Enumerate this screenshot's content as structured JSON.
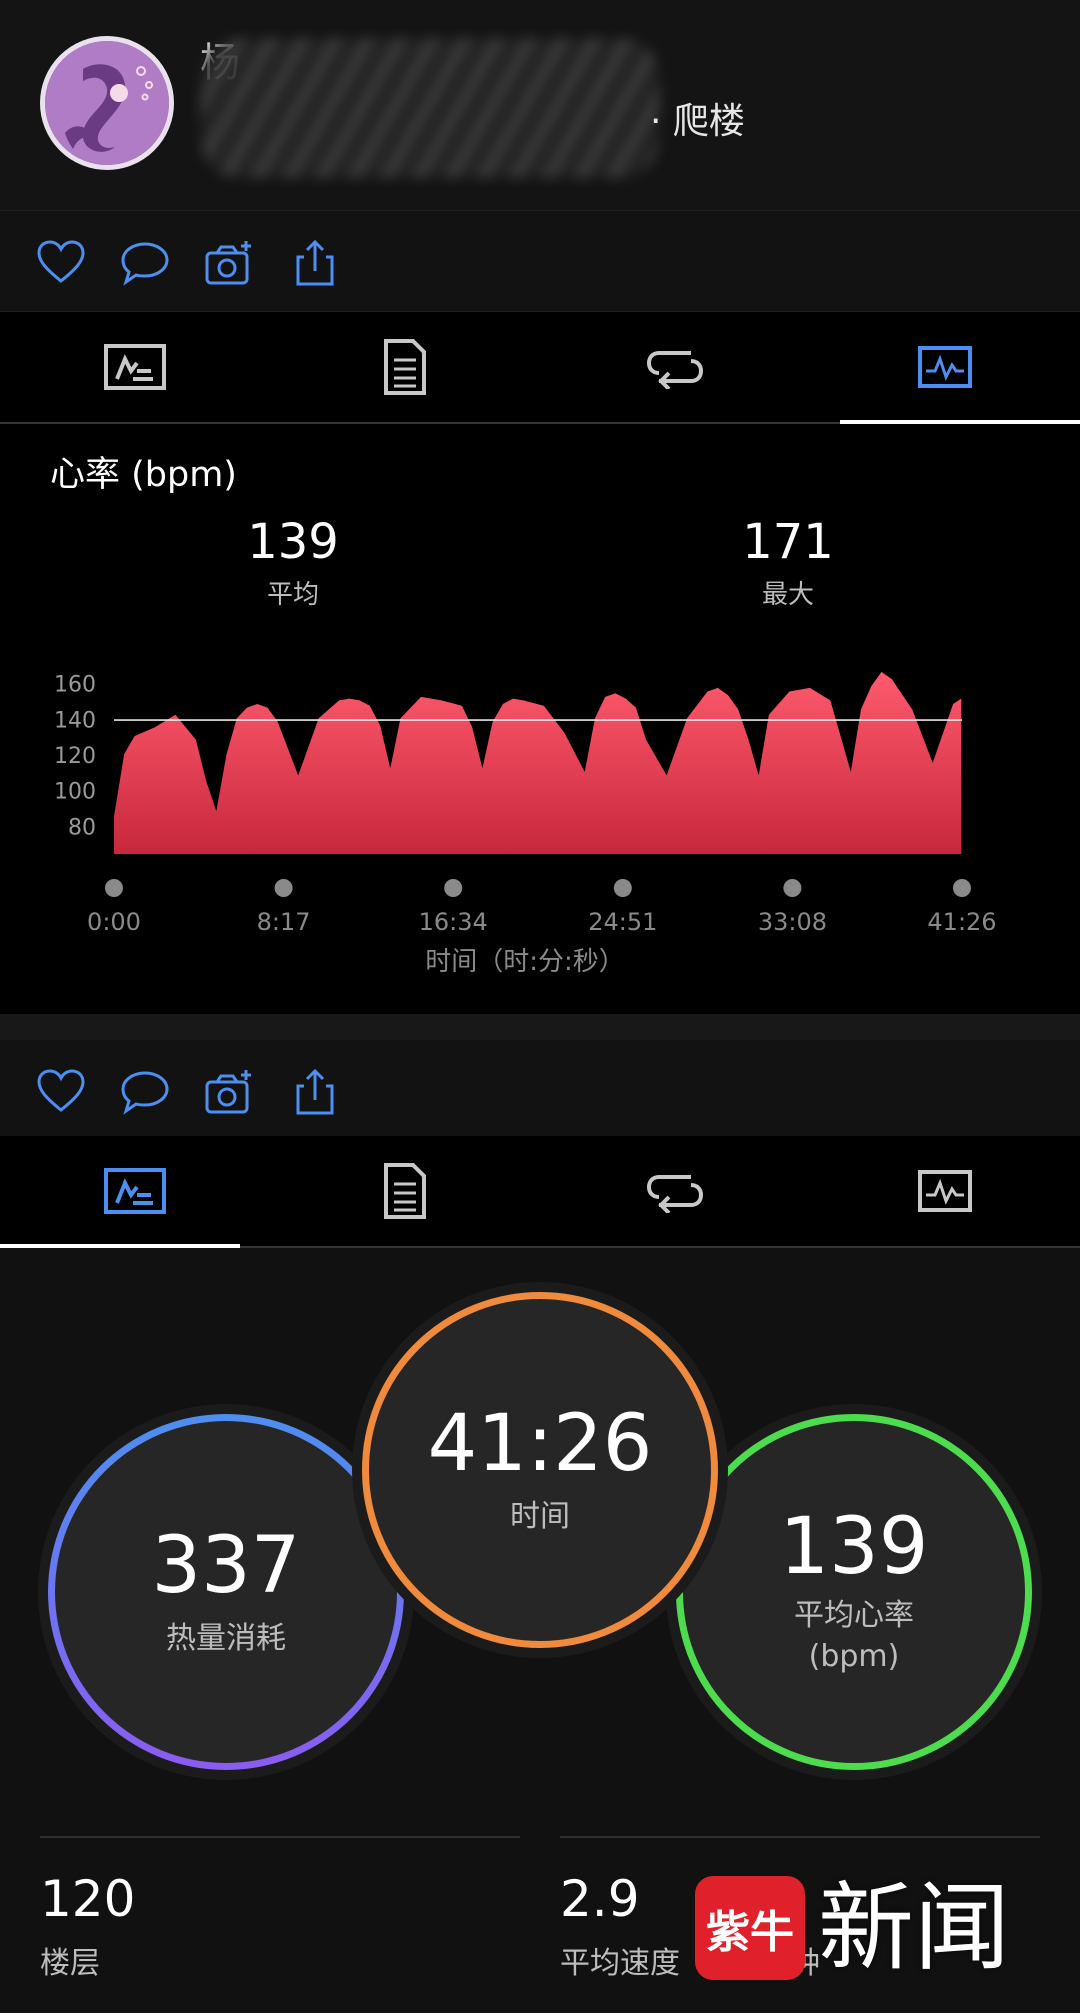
{
  "header": {
    "user_name": "杨",
    "activity_type": "· 爬楼"
  },
  "actions": [
    {
      "name": "like",
      "icon": "heart-icon"
    },
    {
      "name": "comment",
      "icon": "comment-icon"
    },
    {
      "name": "add-photo",
      "icon": "camera-plus-icon"
    },
    {
      "name": "share",
      "icon": "share-icon"
    }
  ],
  "tabs": [
    {
      "name": "summary",
      "icon": "summary-icon"
    },
    {
      "name": "details",
      "icon": "details-icon"
    },
    {
      "name": "laps",
      "icon": "laps-icon"
    },
    {
      "name": "charts",
      "icon": "chart-icon"
    }
  ],
  "heart_rate": {
    "title": "心率 (bpm)",
    "avg_value": "139",
    "avg_label": "平均",
    "max_value": "171",
    "max_label": "最大"
  },
  "chart_data": {
    "type": "area",
    "xlabel": "时间（时:分:秒）",
    "ylabel": "",
    "x_ticks": [
      "0:00",
      "8:17",
      "16:34",
      "24:51",
      "33:08",
      "41:26"
    ],
    "y_ticks": [
      160,
      140,
      120,
      100,
      80
    ],
    "reference_line": 139,
    "ylim": [
      64,
      176
    ],
    "x_minutes": [
      0,
      0.5,
      1,
      2,
      3,
      4,
      4.5,
      5,
      5.5,
      6,
      6.5,
      7,
      7.5,
      8,
      9,
      10,
      11,
      11.5,
      12,
      12.5,
      13,
      13.5,
      14,
      15,
      16,
      17,
      17.5,
      18,
      18.5,
      19,
      19.5,
      20,
      21,
      22,
      23,
      23.5,
      24,
      24.5,
      25,
      25.5,
      26,
      27,
      28,
      29,
      29.5,
      30,
      30.5,
      31,
      31.5,
      32,
      33,
      34,
      35,
      35.5,
      36,
      36.5,
      37,
      37.5,
      38,
      39,
      40,
      41,
      41.4
    ],
    "values": [
      85,
      120,
      130,
      135,
      142,
      128,
      105,
      88,
      120,
      140,
      146,
      148,
      146,
      138,
      108,
      140,
      150,
      151,
      150,
      147,
      136,
      112,
      140,
      152,
      150,
      147,
      135,
      112,
      138,
      148,
      151,
      150,
      147,
      132,
      110,
      140,
      152,
      154,
      151,
      146,
      128,
      108,
      140,
      155,
      157,
      153,
      145,
      128,
      108,
      142,
      155,
      157,
      150,
      130,
      110,
      145,
      158,
      166,
      162,
      145,
      115,
      148,
      151,
      148,
      125
    ],
    "color": "#e8425a",
    "grid": false
  },
  "summary": {
    "calories_value": "337",
    "calories_label": "热量消耗",
    "time_value": "41:26",
    "time_label": "时间",
    "avg_hr_value": "139",
    "avg_hr_label": "平均心率",
    "avg_hr_unit": "(bpm)",
    "floors_value": "120",
    "floors_label": "楼层",
    "speed_value": "2.9",
    "speed_label": "平均速度",
    "speed_unit_tail": "钟"
  },
  "watermark": {
    "logo_text": "紫牛",
    "brand_text": "新闻"
  },
  "colors": {
    "accent_blue": "#4d8ff0",
    "time_ring": "#f08a3c",
    "hr_ring": "#4ddc4d",
    "calorie_ring_start": "#4d8ff0",
    "calorie_ring_end": "#8b5cf0",
    "hr_fill": "#e8425a"
  }
}
